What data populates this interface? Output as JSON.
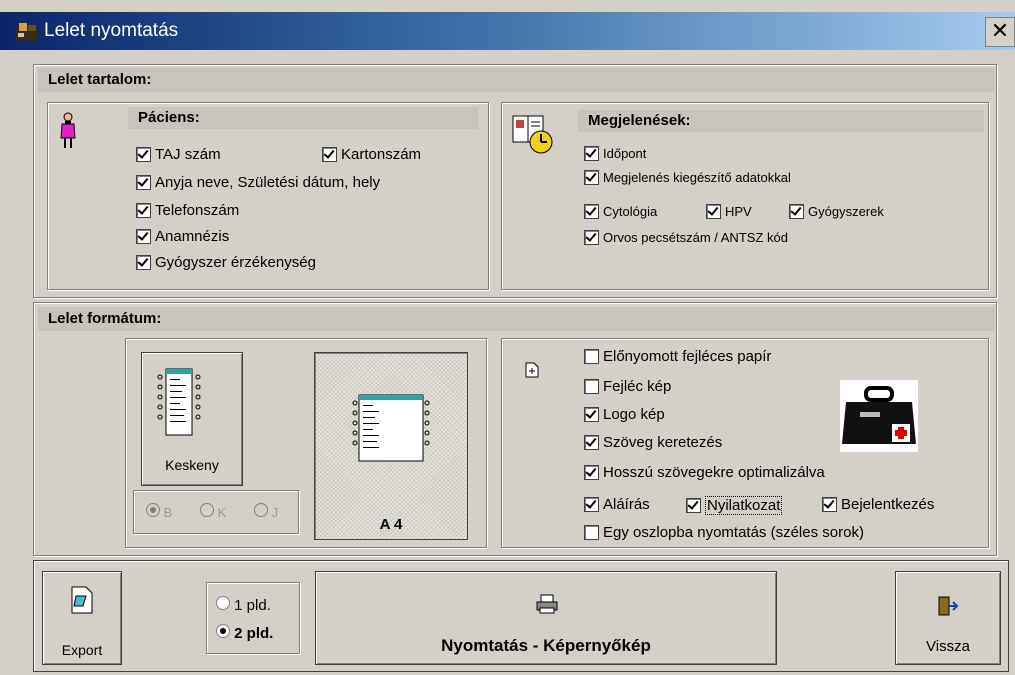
{
  "window": {
    "title": "Lelet nyomtatás",
    "close": "✕"
  },
  "content": {
    "header": "Lelet tartalom:",
    "patient": {
      "header": "Páciens:",
      "items": [
        {
          "label": "TAJ szám",
          "checked": true
        },
        {
          "label": "Kartonszám",
          "checked": true
        },
        {
          "label": "Anyja neve, Születési dátum, hely",
          "checked": true
        },
        {
          "label": "Telefonszám",
          "checked": true
        },
        {
          "label": "Anamnézis",
          "checked": true
        },
        {
          "label": "Gyógyszer érzékenység",
          "checked": true
        }
      ]
    },
    "appear": {
      "header": "Megjelenések:",
      "items": [
        {
          "label": "Időpont",
          "checked": true
        },
        {
          "label": "Megjelenés kiegészítő adatokkal",
          "checked": true
        },
        {
          "label": "Cytológia",
          "checked": true
        },
        {
          "label": "HPV",
          "checked": true
        },
        {
          "label": "Gyógyszerek",
          "checked": true
        },
        {
          "label": "Orvos pecsétszám / ANTSZ kód",
          "checked": true
        }
      ]
    }
  },
  "format": {
    "header": "Lelet formátum:",
    "narrow_label": "Keskeny",
    "a4_label": "A 4",
    "radios": [
      {
        "label": "B",
        "checked": true
      },
      {
        "label": "K",
        "checked": false
      },
      {
        "label": "J",
        "checked": false
      }
    ],
    "options": [
      {
        "label": "Előnyomott fejléces papír",
        "checked": false
      },
      {
        "label": "Fejléc kép",
        "checked": false
      },
      {
        "label": "Logo kép",
        "checked": true
      },
      {
        "label": "Szöveg keretezés",
        "checked": true
      },
      {
        "label": "Hosszú szövegekre optimalizálva",
        "checked": true
      },
      {
        "label": "Aláírás",
        "checked": true
      },
      {
        "label": "Nyilatkozat",
        "checked": true
      },
      {
        "label": "Bejelentkezés",
        "checked": true
      },
      {
        "label": "Egy oszlopba nyomtatás (széles sorok)",
        "checked": false
      }
    ]
  },
  "footer": {
    "export": "Export",
    "copies": [
      {
        "label": "1 pld.",
        "checked": false
      },
      {
        "label": "2 pld.",
        "checked": true
      }
    ],
    "print": "Nyomtatás - Képernyőkép",
    "back": "Vissza"
  }
}
